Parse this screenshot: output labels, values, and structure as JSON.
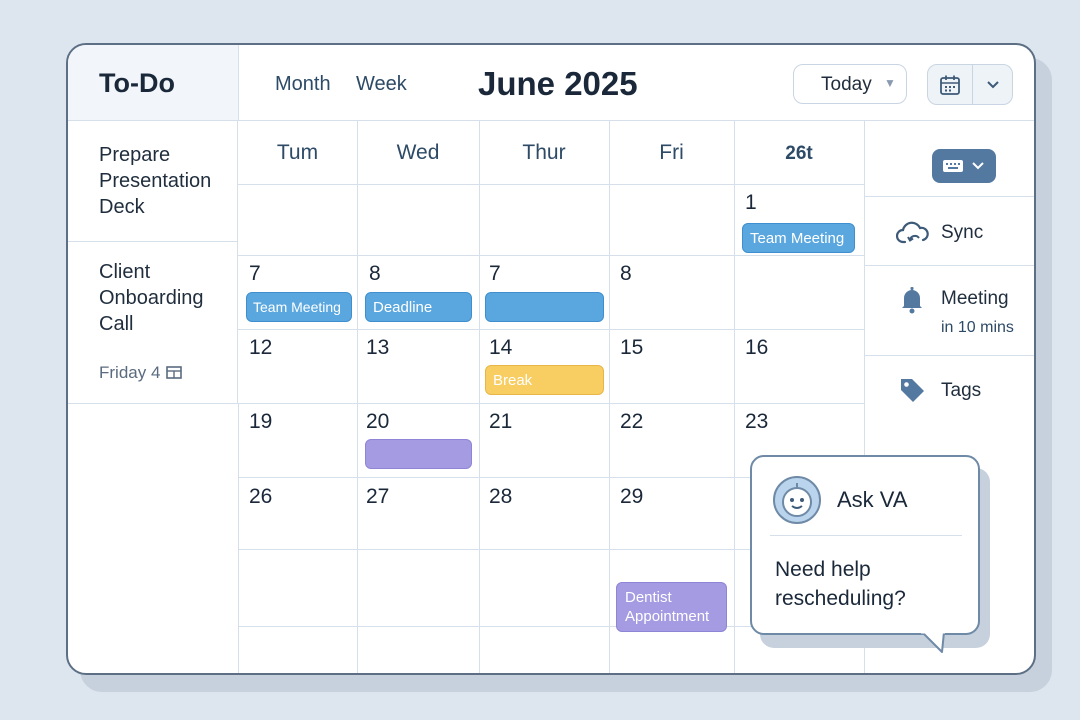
{
  "todo": {
    "title": "To-Do",
    "tasks": [
      {
        "text": "Prepare Presentation Deck"
      },
      {
        "text": "Client Onboarding Call",
        "meta": "Friday  4"
      }
    ]
  },
  "header": {
    "tabs": [
      "Month",
      "Week"
    ],
    "title": "June 2025",
    "today_label": "Today"
  },
  "calendar": {
    "day_headers": [
      "Tum",
      "Wed",
      "Thur",
      "Fri",
      "26t"
    ],
    "weeks": [
      [
        "",
        "",
        "",
        "",
        "1"
      ],
      [
        "7",
        "8",
        "7",
        "8",
        ""
      ],
      [
        "12",
        "13",
        "14",
        "15",
        "16"
      ],
      [
        "19",
        "20",
        "21",
        "22",
        "23"
      ],
      [
        "26",
        "27",
        "28",
        "29",
        ""
      ],
      [
        "",
        "",
        "",
        "",
        ""
      ],
      [
        "",
        "",
        "",
        "",
        ""
      ]
    ],
    "events": [
      {
        "label": "Team Meeting",
        "week": 0,
        "col": 4,
        "color": "blue"
      },
      {
        "label": "Team Meeting",
        "week": 1,
        "col": 0,
        "color": "blue"
      },
      {
        "label": "Deadline",
        "week": 1,
        "col": 1,
        "color": "blue"
      },
      {
        "label": "",
        "week": 1,
        "col": 2,
        "color": "blue"
      },
      {
        "label": "Break",
        "week": 2,
        "col": 2,
        "color": "yellow"
      },
      {
        "label": "",
        "week": 3,
        "col": 1,
        "color": "purple"
      },
      {
        "label": "Dentist Appointment",
        "week": 5,
        "col": 3,
        "color": "purple"
      }
    ],
    "colors": {
      "blue": "#5aa7df",
      "yellow": "#f8cd62",
      "purple": "#a49be2"
    }
  },
  "sidebar": {
    "items": [
      {
        "label": "Sync",
        "icon": "cloud-sync-icon"
      },
      {
        "label": "Meeting",
        "sub": "in 10 mins",
        "icon": "bell-icon"
      },
      {
        "label": "Tags",
        "icon": "tag-icon"
      }
    ]
  },
  "assistant": {
    "title": "Ask VA",
    "message": "Need help rescheduling?"
  }
}
